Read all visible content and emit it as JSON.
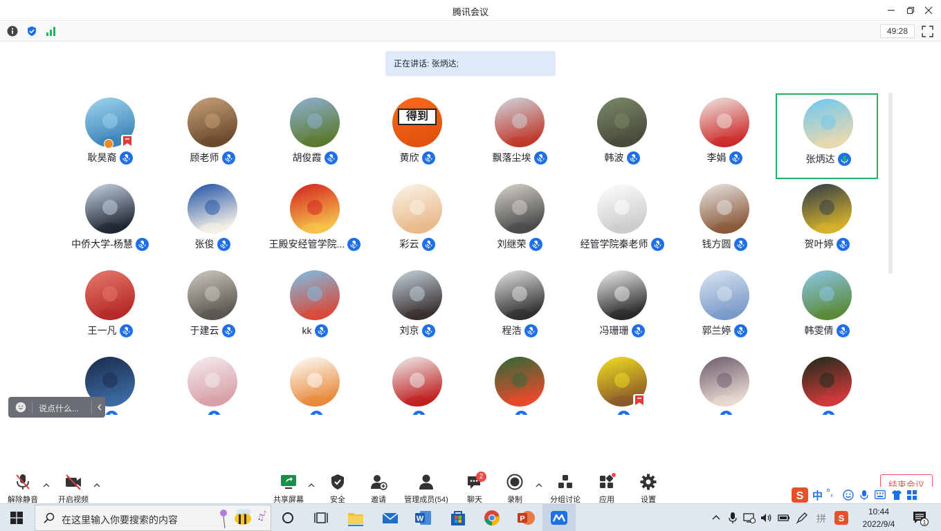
{
  "window": {
    "title": "腾讯会议",
    "timer": "49:28"
  },
  "speaking_banner": "正在讲话: 张炳达;",
  "participants": [
    {
      "name": "耿昊裔",
      "colors": [
        "#9fd6ef",
        "#3d83b8"
      ],
      "host": true,
      "flag": true
    },
    {
      "name": "顾老师",
      "colors": [
        "#c8a27a",
        "#6b4a2c"
      ]
    },
    {
      "name": "胡俊霞",
      "colors": [
        "#8fb3d6",
        "#5c7a30"
      ]
    },
    {
      "name": "黄欣",
      "colors": [
        "#ff6a1a",
        "#e0520d"
      ],
      "text_logo": "得到"
    },
    {
      "name": "飘落尘埃",
      "colors": [
        "#d0d8e0",
        "#c0392b"
      ]
    },
    {
      "name": "韩波",
      "colors": [
        "#7a8a6a",
        "#4a4a3a"
      ]
    },
    {
      "name": "李娟",
      "colors": [
        "#f0e8e2",
        "#cc2b2b"
      ]
    },
    {
      "name": "张炳达",
      "colors": [
        "#6cc8f0",
        "#e8d8b0"
      ],
      "active": true
    },
    {
      "name": "中侨大学-杨慧",
      "colors": [
        "#c9d5e5",
        "#1f2733"
      ]
    },
    {
      "name": "张俊",
      "colors": [
        "#1c4fa6",
        "#f5f0e5"
      ]
    },
    {
      "name": "王殿安经管学院...",
      "colors": [
        "#d11f1f",
        "#f6c34a"
      ]
    },
    {
      "name": "彩云",
      "colors": [
        "#faf4e8",
        "#e9b98a"
      ]
    },
    {
      "name": "刘继荣",
      "colors": [
        "#d8d4cc",
        "#4a4a4a"
      ]
    },
    {
      "name": "经管学院秦老师",
      "colors": [
        "#ffffff",
        "#cccccc"
      ]
    },
    {
      "name": "钱方圆",
      "colors": [
        "#e8e6e4",
        "#8b5a3a"
      ]
    },
    {
      "name": "贺叶婷",
      "colors": [
        "#2c3a4a",
        "#d6b22a"
      ]
    },
    {
      "name": "王一凡",
      "colors": [
        "#e87a6a",
        "#b52a2a"
      ]
    },
    {
      "name": "于建云",
      "colors": [
        "#cfcac2",
        "#5a5650"
      ]
    },
    {
      "name": "kk",
      "colors": [
        "#7cc0e8",
        "#d84a3a"
      ]
    },
    {
      "name": "刘京",
      "colors": [
        "#c6d6e0",
        "#3a3030"
      ]
    },
    {
      "name": "程浩",
      "colors": [
        "#e6e6e6",
        "#303030"
      ]
    },
    {
      "name": "冯珊珊",
      "colors": [
        "#f2f2f2",
        "#2a2a2a"
      ]
    },
    {
      "name": "郭兰婷",
      "colors": [
        "#dbe6f2",
        "#7a9ac8"
      ]
    },
    {
      "name": "韩雯倩",
      "colors": [
        "#8cc8ea",
        "#5a8a3a"
      ]
    },
    {
      "name": "",
      "colors": [
        "#1a2a4a",
        "#3a6aa0"
      ]
    },
    {
      "name": "",
      "colors": [
        "#f4eef0",
        "#d8a0a8"
      ]
    },
    {
      "name": "",
      "colors": [
        "#ffffff",
        "#e88a3a"
      ]
    },
    {
      "name": "",
      "colors": [
        "#f0f0f0",
        "#c02020"
      ]
    },
    {
      "name": "",
      "colors": [
        "#2a6a3a",
        "#e84a2a"
      ]
    },
    {
      "name": "",
      "colors": [
        "#f2e020",
        "#8a5a2a"
      ],
      "flag": true
    },
    {
      "name": "",
      "colors": [
        "#6a5a6a",
        "#e8d8d0"
      ]
    },
    {
      "name": "",
      "colors": [
        "#1a2a1a",
        "#d03a3a"
      ]
    }
  ],
  "chat_input": {
    "placeholder": "说点什么..."
  },
  "toolbar": {
    "unmute": "解除静音",
    "start_video": "开启视频",
    "share_screen": "共享屏幕",
    "security": "安全",
    "invite": "邀请",
    "manage_members": "管理成员(54)",
    "chat": "聊天",
    "chat_badge": "2",
    "record": "录制",
    "breakout": "分组讨论",
    "apps": "应用",
    "settings": "设置",
    "end_meeting": "结束会议"
  },
  "ime": {
    "mode": "中"
  },
  "taskbar": {
    "search_placeholder": "在这里输入你要搜索的内容",
    "time": "10:44",
    "date": "2022/9/4",
    "notification_count": "1"
  },
  "colors": {
    "accent_blue": "#1e6fe8",
    "active_green": "#1db262",
    "end_red": "#e55555",
    "banner_bg": "#dceafb"
  }
}
